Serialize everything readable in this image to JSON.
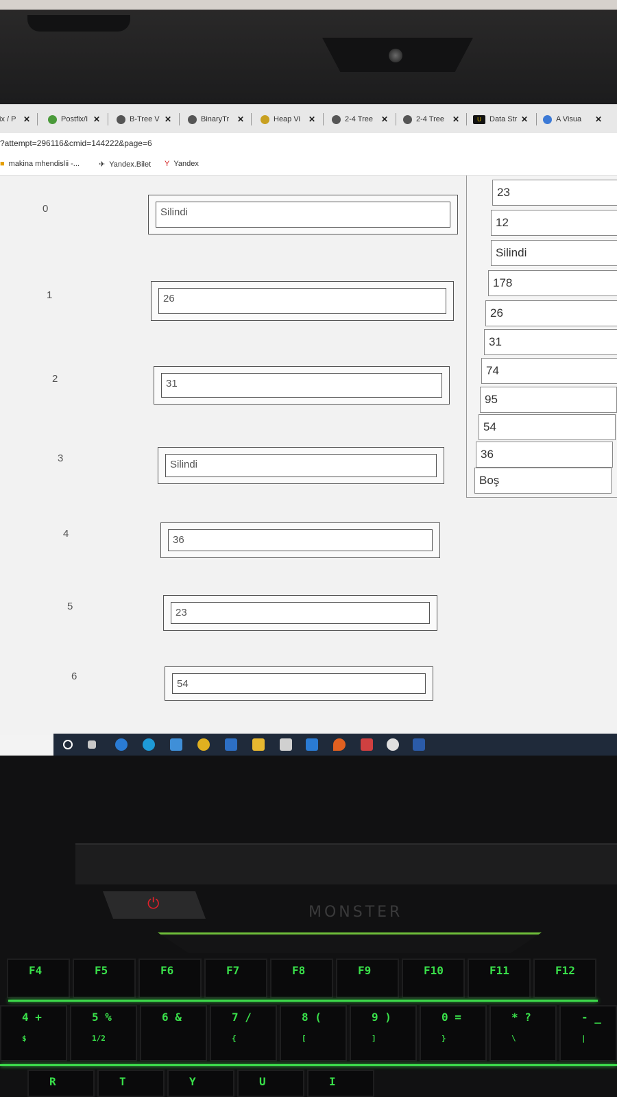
{
  "browser": {
    "tabs": [
      {
        "label": "fix / P",
        "icon": "page-icon"
      },
      {
        "label": "Postfix/I",
        "icon": "leaf-icon"
      },
      {
        "label": "B-Tree V",
        "icon": "globe-icon"
      },
      {
        "label": "BinaryTr",
        "icon": "globe-icon"
      },
      {
        "label": "Heap Vi",
        "icon": "chrome-icon"
      },
      {
        "label": "2-4 Tree",
        "icon": "globe-icon"
      },
      {
        "label": "2-4 Tree",
        "icon": "globe-icon"
      },
      {
        "label": "Data Str",
        "icon": "usf-icon"
      },
      {
        "label": "A Visua",
        "icon": "share-icon"
      }
    ],
    "close_glyph": "✕",
    "address": "?attempt=296116&cmid=144222&page=6",
    "bookmarks": [
      {
        "label": "makina mhendislii -...",
        "icon": "folder-icon"
      },
      {
        "label": "Yandex.Bilet",
        "icon": "plane-icon"
      },
      {
        "label": "Yandex",
        "icon": "yandex-icon"
      }
    ]
  },
  "quiz": {
    "rows": [
      {
        "index": "0",
        "value": "Silindi"
      },
      {
        "index": "1",
        "value": "26"
      },
      {
        "index": "2",
        "value": "31"
      },
      {
        "index": "3",
        "value": "Silindi"
      },
      {
        "index": "4",
        "value": "36"
      },
      {
        "index": "5",
        "value": "23"
      },
      {
        "index": "6",
        "value": "54"
      }
    ],
    "options": [
      "23",
      "12",
      "Silindi",
      "178",
      "26",
      "31",
      "74",
      "95",
      "54",
      "36",
      "Boş"
    ]
  },
  "taskbar": {
    "icons": [
      "start-icon",
      "task-view-icon",
      "ie-icon",
      "edge-icon",
      "app-icon",
      "chrome-icon",
      "app-icon",
      "folder-icon",
      "store-icon",
      "mail-icon",
      "app-icon",
      "app-icon",
      "itunes-icon",
      "word-icon"
    ]
  },
  "laptop": {
    "brand": "MONSTER",
    "power_symbol": "⏻"
  },
  "keyboard": {
    "fn_row": [
      {
        "main": "F4",
        "sub": ""
      },
      {
        "main": "F5",
        "sub": ""
      },
      {
        "main": "F6",
        "sub": ""
      },
      {
        "main": "F7",
        "sub": ""
      },
      {
        "main": "F8",
        "sub": ""
      },
      {
        "main": "F9",
        "sub": ""
      },
      {
        "main": "F10",
        "sub": ""
      },
      {
        "main": "F11",
        "sub": ""
      },
      {
        "main": "F12",
        "sub": ""
      }
    ],
    "num_row": [
      {
        "main": "4 +",
        "sub": "$"
      },
      {
        "main": "5 %",
        "sub": "1/2"
      },
      {
        "main": "6 &",
        "sub": ""
      },
      {
        "main": "7 /",
        "sub": "{"
      },
      {
        "main": "8 (",
        "sub": "["
      },
      {
        "main": "9 )",
        "sub": "]"
      },
      {
        "main": "0 =",
        "sub": "}"
      },
      {
        "main": "* ?",
        "sub": "\\"
      },
      {
        "main": "- _",
        "sub": "|"
      }
    ],
    "letter_row": [
      {
        "main": "R"
      },
      {
        "main": "T"
      },
      {
        "main": "Y"
      },
      {
        "main": "U"
      },
      {
        "main": "I"
      }
    ]
  },
  "colors": {
    "key_glow": "#3cd84a",
    "power_red": "#e0202a",
    "taskbar": "#1f2a3a"
  }
}
